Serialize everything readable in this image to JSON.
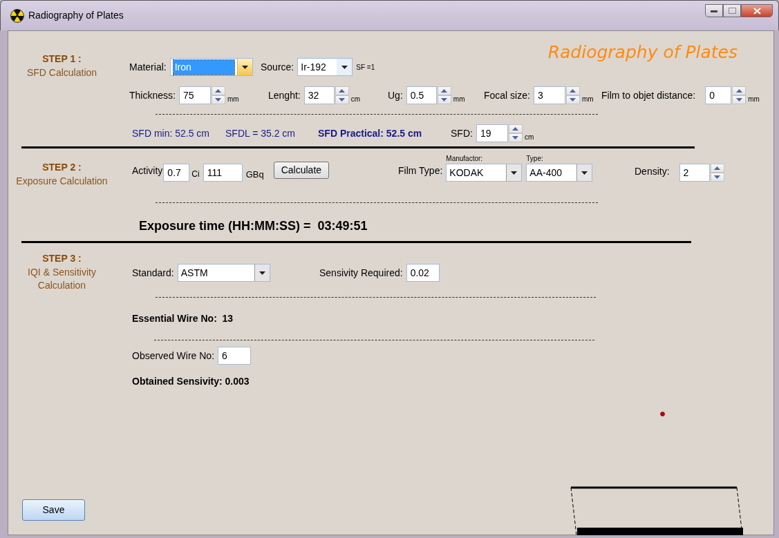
{
  "window": {
    "title": "Radiography of Plates"
  },
  "heading": "Radiography of Plates",
  "steps": [
    {
      "label": "STEP 1 :",
      "subtitle": "SFD Calculation"
    },
    {
      "label": "STEP 2 :",
      "subtitle": "Exposure Calculation"
    },
    {
      "label": "STEP 3 :",
      "subtitle": "IQI & Sensitivity Calculation"
    }
  ],
  "sfd": {
    "material": {
      "label": "Material:",
      "value": "Iron",
      "focused": true
    },
    "source": {
      "label": "Source:",
      "value": "Ir-192",
      "note": "SF =1"
    },
    "spinners": [
      {
        "label": "Thickness:",
        "value": "75",
        "unit": "mm"
      },
      {
        "label": "Lenght:",
        "value": "32",
        "unit": "cm"
      },
      {
        "label": "Ug:",
        "value": "0.5",
        "unit": "mm"
      },
      {
        "label": "Focal size:",
        "value": "3",
        "unit": "mm"
      },
      {
        "label": "Film to objet distance:",
        "value": "0",
        "unit": "mm"
      }
    ],
    "results": [
      {
        "text": "SFD min: 52.5 cm",
        "bold": false
      },
      {
        "text": "SFDL = 35.2 cm",
        "bold": false
      },
      {
        "text": "SFD Practical: 52.5 cm",
        "bold": true
      }
    ],
    "sfd_spinner": {
      "label": "SFD:",
      "value": "19",
      "unit": "cm"
    }
  },
  "exposure": {
    "activity_label": "Activity",
    "activity_ci": "0.7",
    "ci_unit": "Ci",
    "activity_gbq": "111",
    "gbq_unit": "GBq",
    "calculate_button": "Calculate",
    "film_type_label": "Film Type:",
    "manufacturer": {
      "caption": "Manufactor:",
      "value": "KODAK"
    },
    "type": {
      "caption": "Type:",
      "value": "AA-400"
    },
    "density": {
      "label": "Density:",
      "value": "2"
    },
    "result": "Exposure time (HH:MM:SS) =  03:49:51"
  },
  "iqi": {
    "standard_label": "Standard:",
    "standard": "ASTM",
    "required_label": "Sensivity Required:",
    "required": "0.02",
    "essential": "Essential Wire No:  13",
    "observed_label": "Observed Wire No:",
    "observed": "6",
    "obtained": "Obtained Sensivity: 0.003"
  },
  "save_button": "Save"
}
